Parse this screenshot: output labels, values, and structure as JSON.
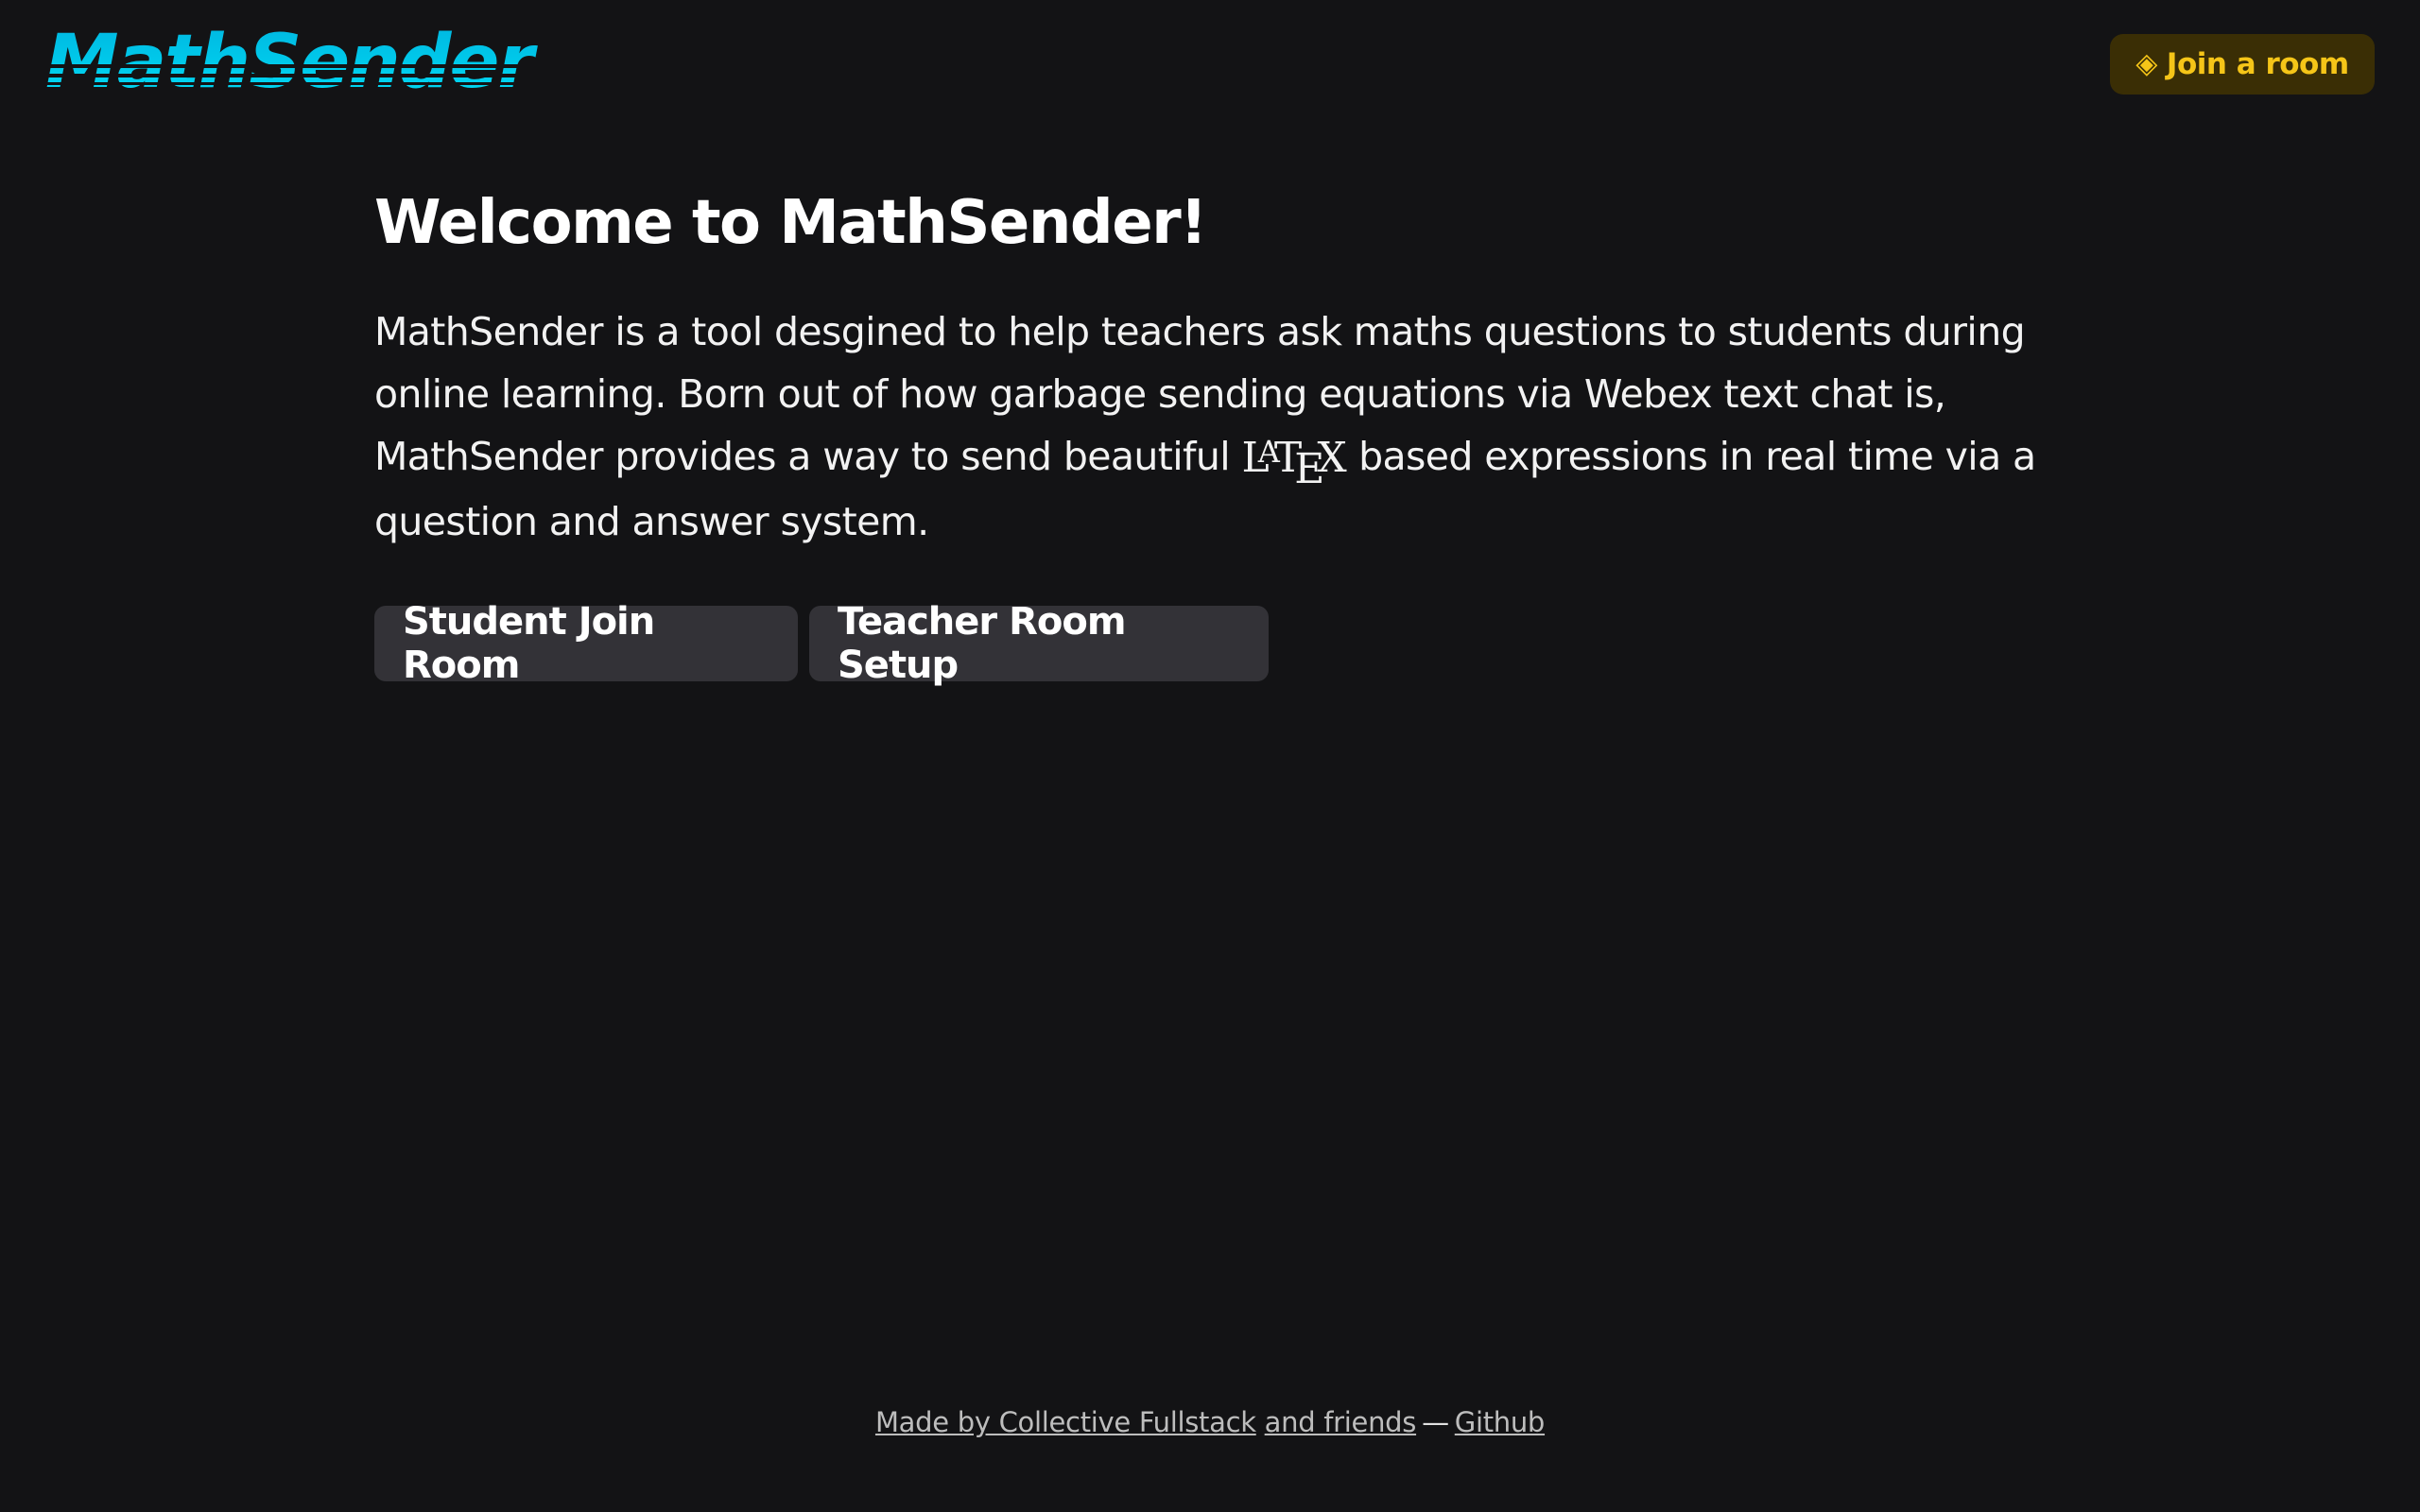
{
  "header": {
    "logo_text": "MathSender",
    "join_button_label": "Join a room",
    "join_button_icon": "diamond-icon"
  },
  "main": {
    "title": "Welcome to MathSender!",
    "intro_before": "MathSender is a tool desgined to help teachers ask maths questions to students during online learning. Born out of how garbage sending equations via Webex text chat is, MathSender provides a way to send beautiful",
    "latex_logo": "LaTeX",
    "intro_after": "based expressions in real time via a question and answer system.",
    "buttons": {
      "student_label": "Student Join Room",
      "teacher_label": "Teacher Room Setup"
    }
  },
  "footer": {
    "made_by_link": "Made by Collective Fullstack",
    "friends_link": "and friends",
    "separator": "—",
    "github_link": "Github"
  },
  "colors": {
    "background": "#131315",
    "logo_gradient_top": "#00bfe6",
    "logo_gradient_bottom": "#00d8f2",
    "join_button_bg": "#3a2e05",
    "join_button_text": "#f5c518",
    "button_bg": "#333237",
    "footer_text": "#bdbdbd"
  }
}
